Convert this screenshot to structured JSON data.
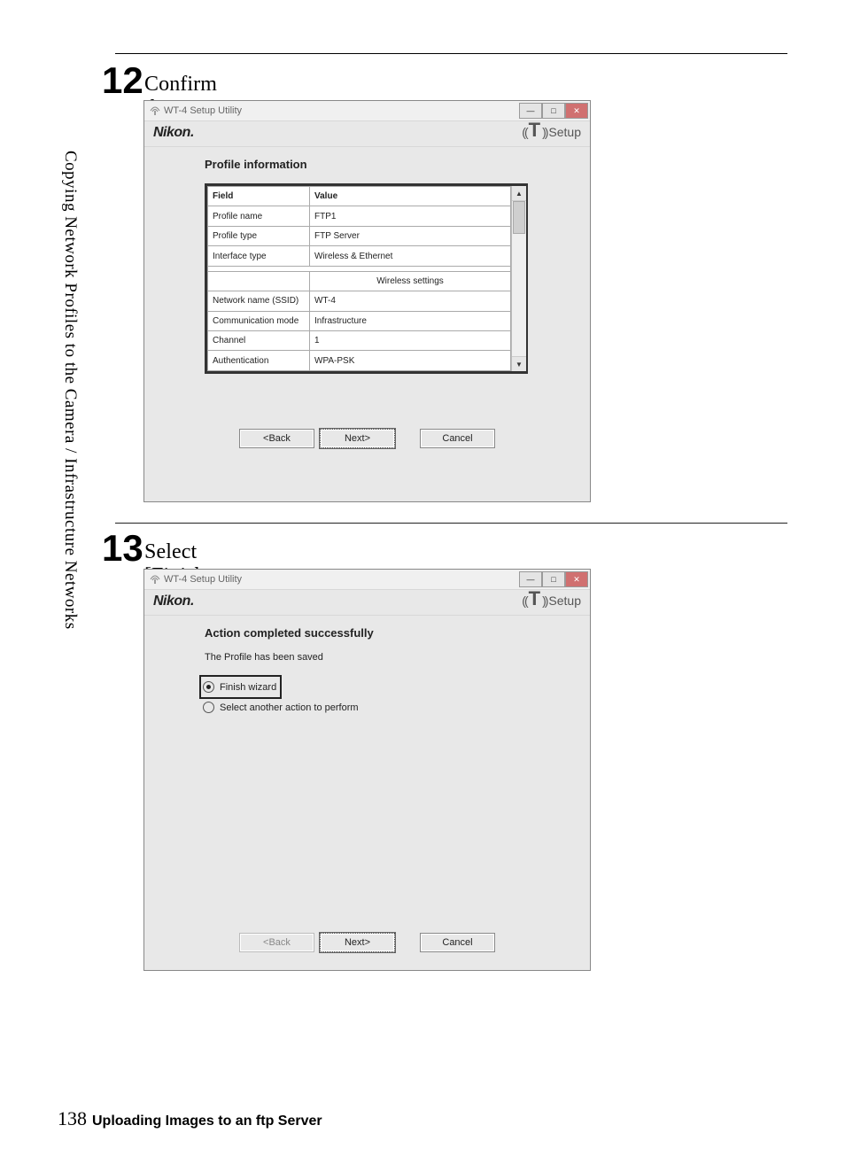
{
  "sidebar": {
    "text": "Copying Network Profiles to the Camera / Infrastructure Networks"
  },
  "step12": {
    "num": "12",
    "text": "Confirm that settings are correct and click [Next]."
  },
  "step13": {
    "num": "13",
    "text": "Select [Finish wizard] and click [Next]."
  },
  "dialog_common": {
    "title": "WT-4 Setup Utility",
    "nikon": "Nikon.",
    "setup": "Setup",
    "back": "<Back",
    "next": "Next>",
    "cancel": "Cancel"
  },
  "dlg12": {
    "section": "Profile information",
    "head_field": "Field",
    "head_value": "Value",
    "rows": [
      {
        "f": "Profile name",
        "v": "FTP1"
      },
      {
        "f": "Profile type",
        "v": "FTP Server"
      },
      {
        "f": "Interface type",
        "v": "Wireless & Ethernet"
      }
    ],
    "sub": "Wireless settings",
    "rows2": [
      {
        "f": "Network name (SSID)",
        "v": "WT-4"
      },
      {
        "f": "Communication mode",
        "v": "Infrastructure"
      },
      {
        "f": "Channel",
        "v": "1"
      },
      {
        "f": "Authentication",
        "v": "WPA-PSK"
      }
    ]
  },
  "dlg13": {
    "section": "Action completed successfully",
    "saved": "The Profile has been saved",
    "opt1": "Finish wizard",
    "opt2": "Select another action to perform"
  },
  "footer": {
    "pageno": "138",
    "text": "Uploading Images to an ftp Server"
  }
}
